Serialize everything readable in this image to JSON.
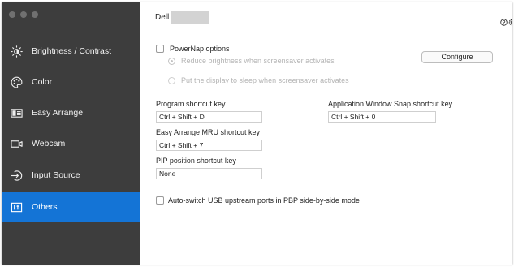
{
  "sidebar": {
    "items": [
      {
        "label": "Brightness / Contrast",
        "icon": "brightness-icon"
      },
      {
        "label": "Color",
        "icon": "color-palette-icon"
      },
      {
        "label": "Easy Arrange",
        "icon": "easy-arrange-icon"
      },
      {
        "label": "Webcam",
        "icon": "webcam-icon"
      },
      {
        "label": "Input Source",
        "icon": "input-source-icon"
      },
      {
        "label": "Others",
        "icon": "others-icon",
        "active": true
      }
    ]
  },
  "header": {
    "title": "Dell"
  },
  "powernap": {
    "label": "PowerNap options",
    "checked": false,
    "option_reduce": "Reduce brightness when screensaver activates",
    "option_sleep": "Put the display to sleep when screensaver activates",
    "configure_label": "Configure"
  },
  "shortcuts": {
    "program_label": "Program shortcut key",
    "program_value": "Ctrl + Shift + D",
    "app_snap_label": "Application Window Snap shortcut key",
    "app_snap_value": "Ctrl + Shift + 0",
    "mru_label": "Easy Arrange MRU shortcut key",
    "mru_value": "Ctrl + Shift + 7",
    "pip_label": "PIP position shortcut key",
    "pip_value": "None"
  },
  "usb": {
    "label": "Auto-switch USB upstream ports in PBP side-by-side mode",
    "checked": false
  },
  "colors": {
    "sidebar_bg": "#3d3d3d",
    "active_bg": "#1474d6"
  }
}
